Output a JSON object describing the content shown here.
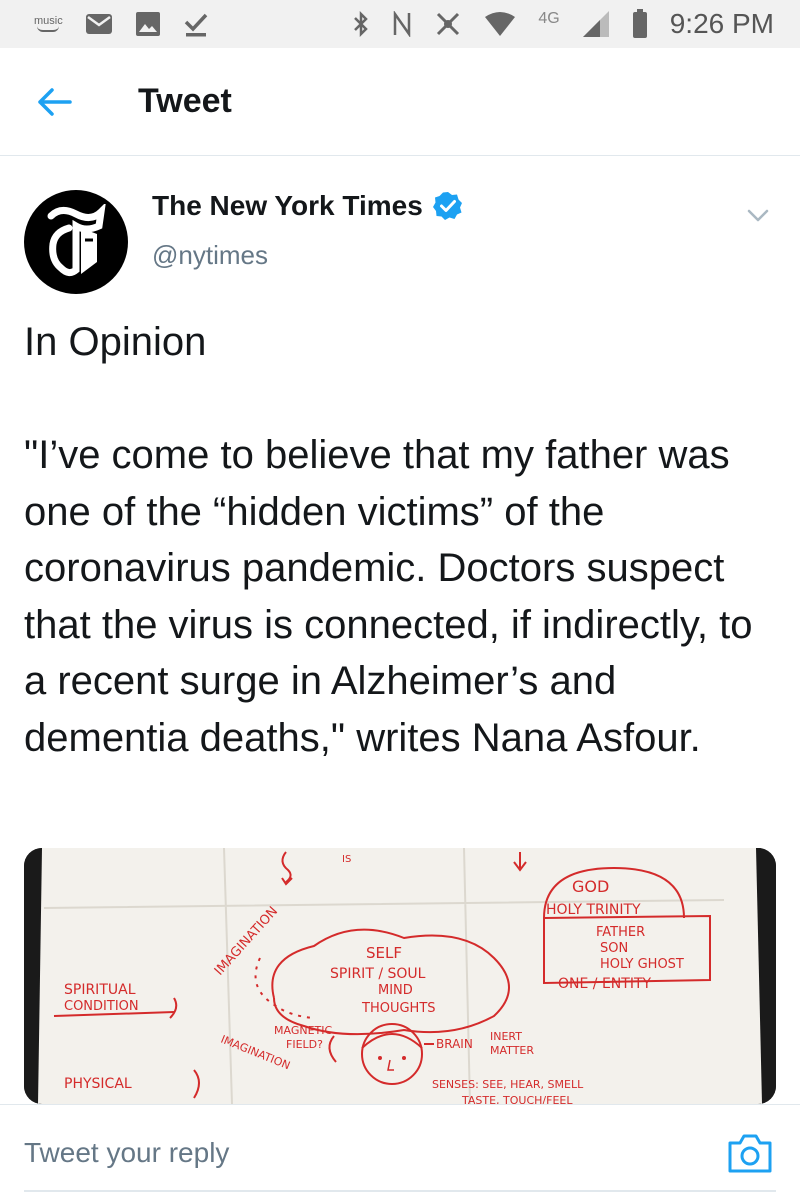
{
  "status_bar": {
    "music_label": "music",
    "network": "4G",
    "time": "9:26 PM"
  },
  "header": {
    "title": "Tweet"
  },
  "tweet": {
    "author_name": "The New York Times",
    "author_handle": "@nytimes",
    "verified": true,
    "text": "In Opinion\n\n\"I’ve come to believe that my father was one of the “hidden victims” of the coronavirus pandemic. Doctors suspect that the virus is connected, if indirectly, to a recent surge in Alzheimer’s and dementia deaths,\" writes Nana Asfour."
  },
  "media": {
    "labels": {
      "god": "GOD",
      "holy_trinity": "HOLY TRINITY",
      "father": "FATHER",
      "son": "SON",
      "holy_ghost": "HOLY GHOST",
      "one_entity": "ONE / ENTITY",
      "self": "SELF",
      "spirit_soul": "SPIRIT / SOUL",
      "mind": "MIND",
      "thoughts": "THOUGHTS",
      "spiritual": "SPIRITUAL",
      "condition": "CONDITION",
      "imagination_arc": "IMAGINATION",
      "imagination_lower": "IMAGINATION",
      "magnetic": "MAGNETIC",
      "field": "FIELD?",
      "brain": "BRAIN",
      "inert": "INERT",
      "matter": "MATTER",
      "physical": "PHYSICAL",
      "senses": "SENSES: SEE, HEAR, SMELL",
      "taste": "TASTE, TOUCH/FEEL",
      "is": "IS"
    }
  },
  "reply": {
    "placeholder": "Tweet your reply"
  },
  "colors": {
    "accent": "#1da1f2",
    "text": "#14171a",
    "secondary": "#657786",
    "ink": "#d42b2b"
  },
  "icons": {
    "back": "arrow-left-icon",
    "verified": "verified-badge-icon",
    "caret": "chevron-down-icon",
    "camera": "camera-icon"
  }
}
